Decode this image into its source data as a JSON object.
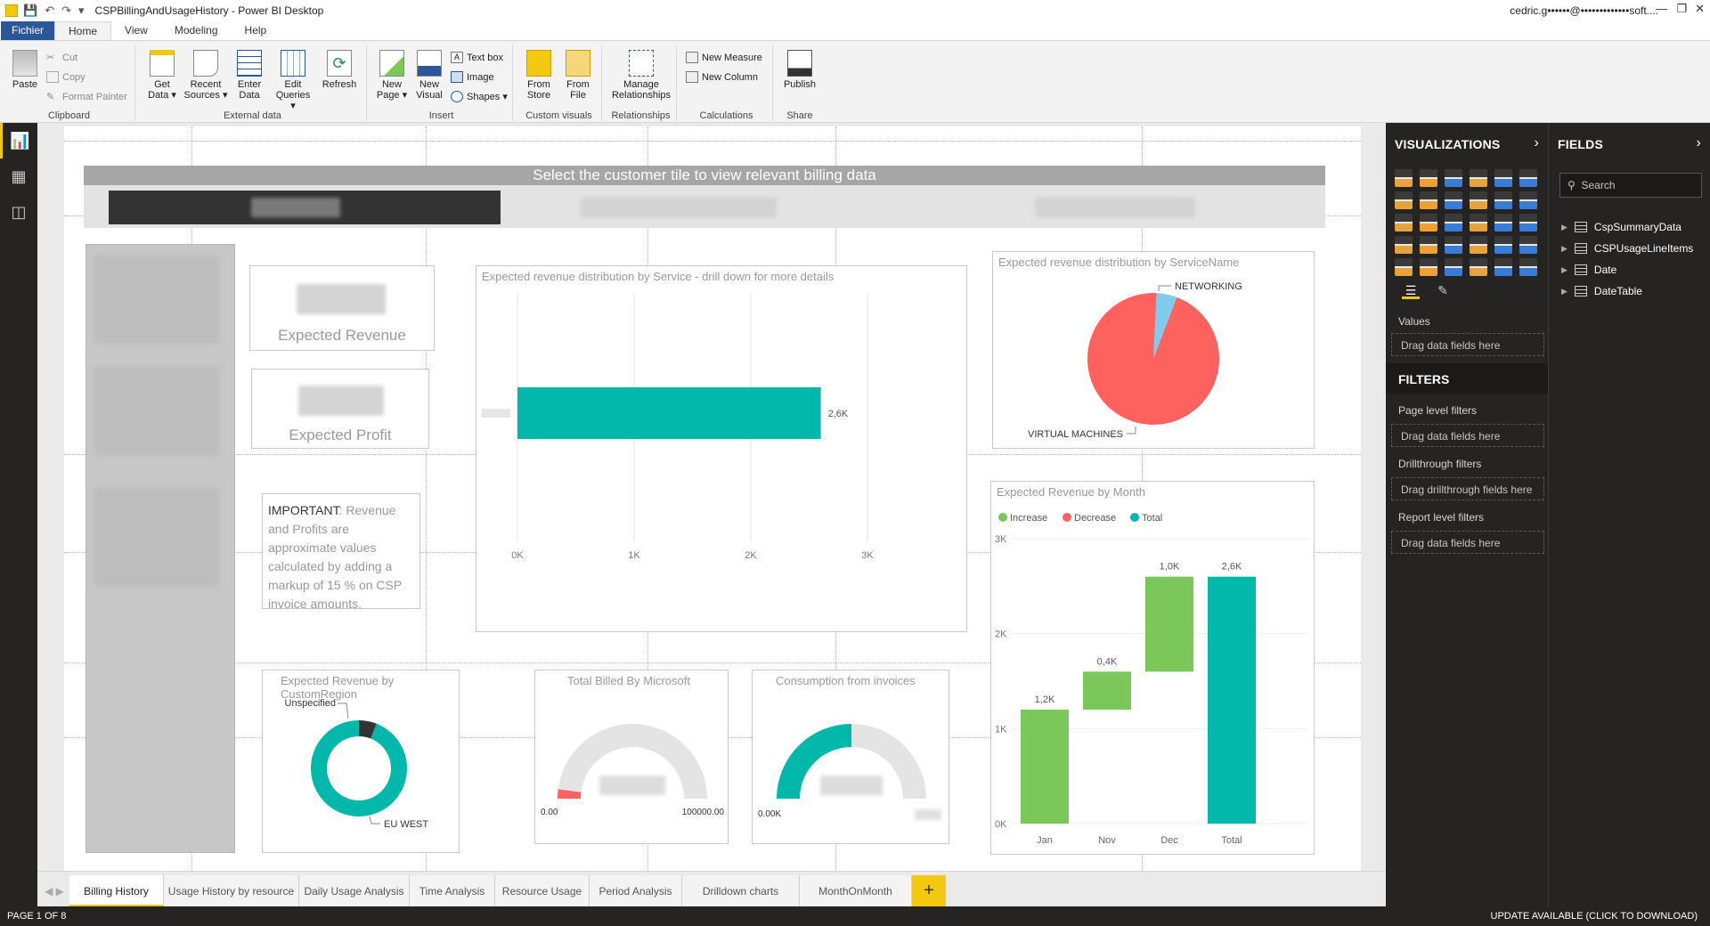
{
  "window": {
    "title": "CSPBillingAndUsageHistory - Power BI Desktop",
    "user": "cedric.g••••••@•••••••••••••soft...."
  },
  "tabs": [
    "Fichier",
    "Home",
    "View",
    "Modeling",
    "Help"
  ],
  "ribbon": {
    "clipboard": {
      "label": "Clipboard",
      "paste": "Paste",
      "cut": "Cut",
      "copy": "Copy",
      "format_painter": "Format Painter"
    },
    "external": {
      "label": "External data",
      "get_data": "Get Data",
      "recent_sources": "Recent Sources",
      "enter_data": "Enter Data",
      "edit_queries": "Edit Queries",
      "refresh": "Refresh"
    },
    "insert": {
      "label": "Insert",
      "new_page": "New Page",
      "new_visual": "New Visual",
      "text_box": "Text box",
      "image": "Image",
      "shapes": "Shapes"
    },
    "custom": {
      "label": "Custom visuals",
      "from_store": "From Store",
      "from_file": "From File"
    },
    "relationships": {
      "label": "Relationships",
      "manage": "Manage Relationships"
    },
    "calculations": {
      "label": "Calculations",
      "new_measure": "New Measure",
      "new_column": "New Column"
    },
    "share": {
      "label": "Share",
      "publish": "Publish"
    }
  },
  "report": {
    "banner": "Select the customer tile to view relevant billing data",
    "kpi_revenue_label": "Expected Revenue",
    "kpi_profit_label": "Expected Profit",
    "note_bold": "IMPORTANT",
    "note_rest": ": Revenue and Profits are approximate values calculated by adding a markup of 15 % on CSP invoice amounts.",
    "bar_title": "Expected revenue distribution by Service - drill down for more details",
    "bar_value_label": "2,6K",
    "bar_ticks": [
      "0K",
      "1K",
      "2K",
      "3K"
    ],
    "pie_title": "Expected revenue distribution by ServiceName",
    "pie_label_1": "NETWORKING",
    "pie_label_2": "VIRTUAL MACHINES",
    "donut_title": "Expected Revenue by CustomRegion",
    "donut_label_1": "Unspecified",
    "donut_label_2": "EU WEST",
    "gauge1_title": "Total Billed By Microsoft",
    "gauge1_min": "0.00",
    "gauge1_max": "100000.00",
    "gauge2_title": "Consumption from invoices",
    "gauge2_min": "0.00K",
    "waterfall_title": "Expected Revenue by Month",
    "legend_increase": "Increase",
    "legend_decrease": "Decrease",
    "legend_total": "Total",
    "wf_yticks": [
      "3K",
      "2K",
      "1K",
      "0K"
    ],
    "wf_labels": [
      "1,2K",
      "0,4K",
      "1,0K",
      "2,6K"
    ],
    "wf_cats": [
      "Jan",
      "Nov",
      "Dec",
      "Total"
    ]
  },
  "chart_data": [
    {
      "type": "bar",
      "title": "Expected revenue distribution by Service - drill down for more details",
      "categories": [
        "[blurred]"
      ],
      "values": [
        2600
      ],
      "xlim": [
        0,
        3000
      ]
    },
    {
      "type": "pie",
      "title": "Expected revenue distribution by ServiceName",
      "categories": [
        "NETWORKING",
        "VIRTUAL MACHINES"
      ],
      "values": [
        5,
        95
      ]
    },
    {
      "type": "pie",
      "title": "Expected Revenue by CustomRegion",
      "categories": [
        "Unspecified",
        "EU WEST"
      ],
      "values": [
        6,
        94
      ]
    },
    {
      "type": "bar",
      "title": "Expected Revenue by Month",
      "categories": [
        "Jan",
        "Nov",
        "Dec",
        "Total"
      ],
      "series": [
        {
          "name": "Increase",
          "values": [
            1200,
            400,
            1000,
            null
          ]
        },
        {
          "name": "Total",
          "values": [
            null,
            null,
            null,
            2600
          ]
        }
      ],
      "ylim": [
        0,
        3000
      ]
    }
  ],
  "viz_pane": {
    "title": "VISUALIZATIONS",
    "values_label": "Values",
    "drag_fields": "Drag data fields here",
    "filters_title": "FILTERS",
    "page_filters": "Page level filters",
    "drillthrough_filters": "Drillthrough filters",
    "drag_drillthrough": "Drag drillthrough fields here",
    "report_filters": "Report level filters"
  },
  "fields_pane": {
    "title": "FIELDS",
    "search_placeholder": "Search",
    "tables": [
      "CspSummaryData",
      "CSPUsageLineItems",
      "Date",
      "DateTable"
    ]
  },
  "page_tabs": [
    "Billing History",
    "Usage History by resource",
    "Daily Usage Analysis",
    "Time Analysis",
    "Resource Usage",
    "Period Analysis",
    "Drilldown charts",
    "MonthOnMonth"
  ],
  "add_page": "+",
  "status": {
    "page": "PAGE 1 OF 8",
    "update": "UPDATE AVAILABLE (CLICK TO DOWNLOAD)"
  },
  "colors": {
    "teal": "#01b8aa",
    "green": "#7bc759",
    "red": "#fd625e",
    "lightblue": "#7fcdee",
    "accent": "#f2c811",
    "dark": "#252423"
  }
}
